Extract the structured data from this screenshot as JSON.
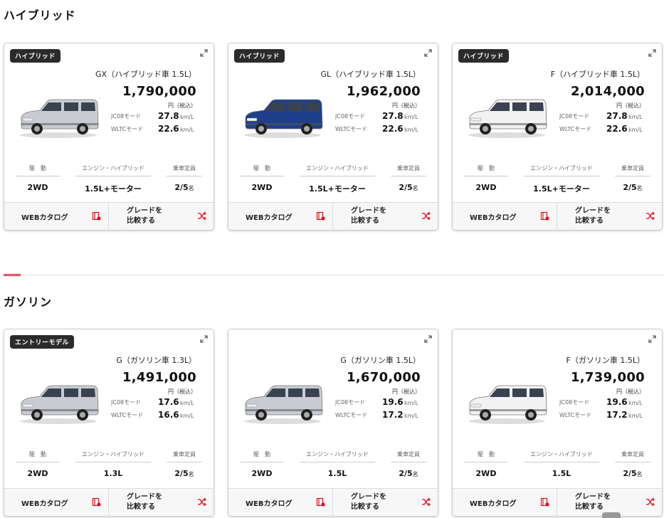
{
  "sections": [
    {
      "title": "ハイブリッド",
      "cards": [
        {
          "badge": "ハイブリッド",
          "grade": "GX（ハイブリッド車 1.5L）",
          "price": "1,790,000",
          "price_unit": "円（税込）",
          "jc08_label": "JC08モード",
          "jc08": "27.8",
          "wltc_label": "WLTCモード",
          "wltc": "22.6",
          "unit": "km/L",
          "specs": [
            {
              "label": "駆　動",
              "value": "2WD"
            },
            {
              "label": "エンジン・ハイブリッド",
              "value": "1.5L+モーター"
            },
            {
              "label": "乗車定員",
              "value": "2/5",
              "suffix": "名"
            }
          ],
          "car_color": "#c8ccd2",
          "catalog": "WEBカタログ",
          "compare": "グレードを\n比較する"
        },
        {
          "badge": "ハイブリッド",
          "grade": "GL（ハイブリッド車 1.5L）",
          "price": "1,962,000",
          "price_unit": "円（税込）",
          "jc08_label": "JC08モード",
          "jc08": "27.8",
          "wltc_label": "WLTCモード",
          "wltc": "22.6",
          "unit": "km/L",
          "specs": [
            {
              "label": "駆　動",
              "value": "2WD"
            },
            {
              "label": "エンジン・ハイブリッド",
              "value": "1.5L+モーター"
            },
            {
              "label": "乗車定員",
              "value": "2/5",
              "suffix": "名"
            }
          ],
          "car_color": "#1f3f8a",
          "catalog": "WEBカタログ",
          "compare": "グレードを\n比較する"
        },
        {
          "badge": "ハイブリッド",
          "grade": "F（ハイブリッド車 1.5L）",
          "price": "2,014,000",
          "price_unit": "円（税込）",
          "jc08_label": "JC08モード",
          "jc08": "27.8",
          "wltc_label": "WLTCモード",
          "wltc": "22.6",
          "unit": "km/L",
          "specs": [
            {
              "label": "駆　動",
              "value": "2WD"
            },
            {
              "label": "エンジン・ハイブリッド",
              "value": "1.5L+モーター"
            },
            {
              "label": "乗車定員",
              "value": "2/5",
              "suffix": "名"
            }
          ],
          "car_color": "#f2f2f2",
          "catalog": "WEBカタログ",
          "compare": "グレードを\n比較する"
        }
      ]
    },
    {
      "title": "ガソリン",
      "cards": [
        {
          "badge": "エントリーモデル",
          "grade": "G（ガソリン車 1.3L）",
          "price": "1,491,000",
          "price_unit": "円（税込）",
          "jc08_label": "JC08モード",
          "jc08": "17.6",
          "wltc_label": "WLTCモード",
          "wltc": "16.6",
          "unit": "km/L",
          "specs": [
            {
              "label": "駆　動",
              "value": "2WD"
            },
            {
              "label": "エンジン・ハイブリッド",
              "value": "1.3L"
            },
            {
              "label": "乗車定員",
              "value": "2/5",
              "suffix": "名"
            }
          ],
          "car_color": "#c8ccd2",
          "catalog": "WEBカタログ",
          "compare": "グレードを\n比較する"
        },
        {
          "badge": "",
          "grade": "G（ガソリン車 1.5L）",
          "price": "1,670,000",
          "price_unit": "円（税込）",
          "jc08_label": "JC08モード",
          "jc08": "19.6",
          "wltc_label": "WLTCモード",
          "wltc": "17.2",
          "unit": "km/L",
          "specs": [
            {
              "label": "駆　動",
              "value": "2WD"
            },
            {
              "label": "エンジン・ハイブリッド",
              "value": "1.5L"
            },
            {
              "label": "乗車定員",
              "value": "2/5",
              "suffix": "名"
            }
          ],
          "car_color": "#c8ccd2",
          "catalog": "WEBカタログ",
          "compare": "グレードを\n比較する"
        },
        {
          "badge": "",
          "grade": "F（ガソリン車 1.5L）",
          "price": "1,739,000",
          "price_unit": "円（税込）",
          "jc08_label": "JC08モード",
          "jc08": "19.6",
          "wltc_label": "WLTCモード",
          "wltc": "17.2",
          "unit": "km/L",
          "specs": [
            {
              "label": "駆　動",
              "value": "2WD"
            },
            {
              "label": "エンジン・ハイブリッド",
              "value": "1.5L"
            },
            {
              "label": "乗車定員",
              "value": "2/5",
              "suffix": "名"
            }
          ],
          "car_color": "#f2f2f2",
          "catalog": "WEBカタログ",
          "compare": "グレードを\n比較する"
        }
      ]
    }
  ],
  "colors": {
    "accent": "#e60012",
    "badge_bg": "#2b2b2b"
  },
  "icons": {
    "expand": "expand-icon",
    "catalog": "catalog-book-icon",
    "compare": "shuffle-compare-icon"
  }
}
